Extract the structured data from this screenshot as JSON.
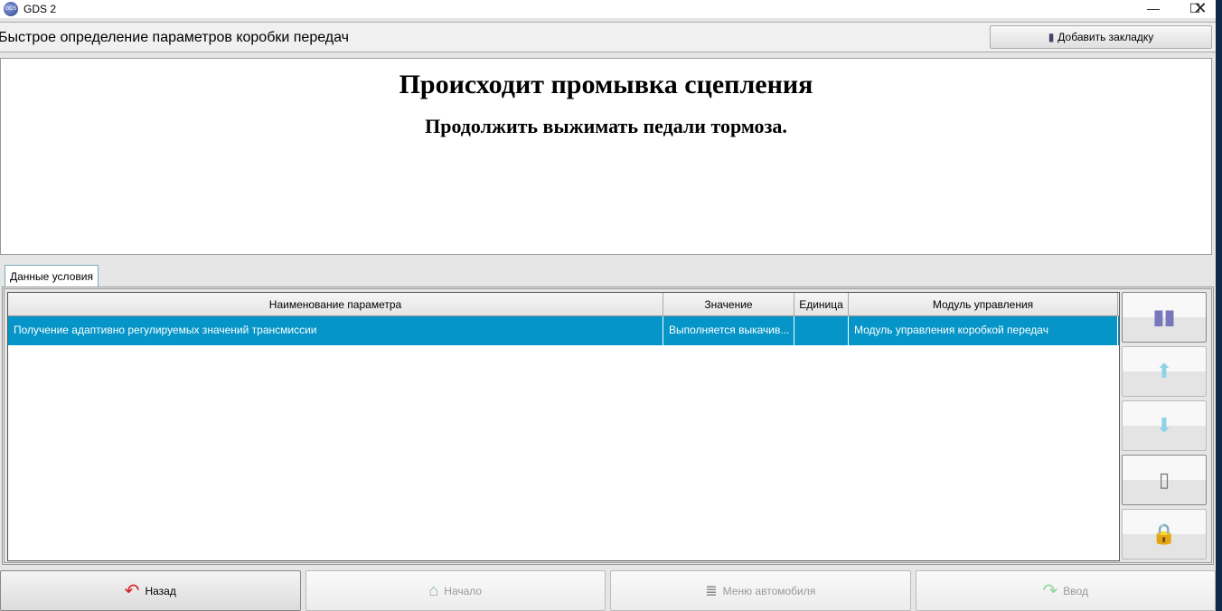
{
  "window": {
    "title": "GDS 2"
  },
  "header": {
    "title": "Быстрое определение параметров коробки передач",
    "bookmark_label": "Добавить закладку"
  },
  "message": {
    "title": "Происходит промывка сцепления",
    "subtitle": "Продолжить выжимать педали тормоза."
  },
  "tabs": [
    {
      "label": "Данные условия"
    }
  ],
  "table": {
    "columns": [
      "Наименование параметра",
      "Значение",
      "Единица",
      "Модуль управления"
    ],
    "rows": [
      [
        "Получение адаптивно регулируемых значений трансмиссии",
        "Выполняется выкачив...",
        "",
        "Модуль управления коробкой передач"
      ]
    ]
  },
  "footer": {
    "back": "Назад",
    "home": "Начало",
    "vehicle_menu": "Меню автомобиля",
    "enter": "Ввод"
  },
  "colors": {
    "selection": "#0595c8"
  }
}
